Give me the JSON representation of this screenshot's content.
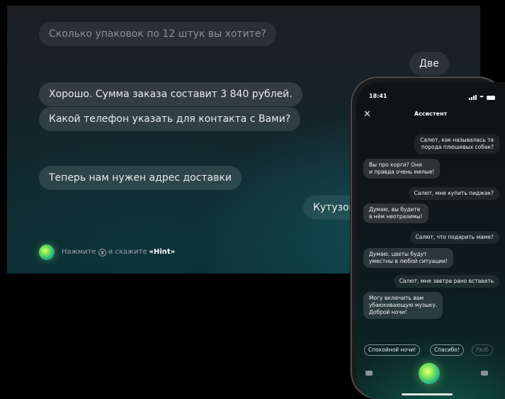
{
  "tv": {
    "messages": [
      {
        "role": "assistant",
        "text": "Сколько упаковок по 12 штук вы хотите?"
      },
      {
        "role": "user",
        "text": "Две"
      },
      {
        "role": "assistant",
        "text": "Хорошо. Сумма заказа составит 3 840 рублей."
      },
      {
        "role": "assistant",
        "text": "Какой телефон указать для контакта с Вами?"
      },
      {
        "role": "assistant",
        "text": "Теперь нам нужен адрес доставки"
      },
      {
        "role": "user",
        "text": "Кутузов"
      }
    ],
    "hint": {
      "prefix": "Нажмите",
      "middle": "и скажите",
      "keyword": "«Hint»"
    }
  },
  "phone": {
    "time": "18:41",
    "title": "Ассистент",
    "messages": [
      {
        "role": "user",
        "text": "Салют, как называлась та\nпорода плюшевых собак?"
      },
      {
        "role": "assistant",
        "text": "Вы про корги? Они\nи правда очень милые!"
      },
      {
        "role": "user",
        "text": "Салют, мне купить пиджак?"
      },
      {
        "role": "assistant",
        "text": "Думаю, вы будете\nв нём неотразимы!"
      },
      {
        "role": "user",
        "text": "Салют, что подарить маме?"
      },
      {
        "role": "assistant",
        "text": "Думаю, цветы будут\nуместны в любой ситуации!"
      },
      {
        "role": "user",
        "text": "Салют, мне завтра рано вставать"
      },
      {
        "role": "assistant",
        "text": "Могу включить вам\nубаюкивающую музыку.\nДоброй ночи!"
      }
    ],
    "suggestions": [
      "Спокойной ночи!",
      "Спасибо!",
      "Разб"
    ],
    "icons": [
      "close-icon",
      "keyboard-icon",
      "assistant-orb",
      "keyboard-icon"
    ]
  }
}
